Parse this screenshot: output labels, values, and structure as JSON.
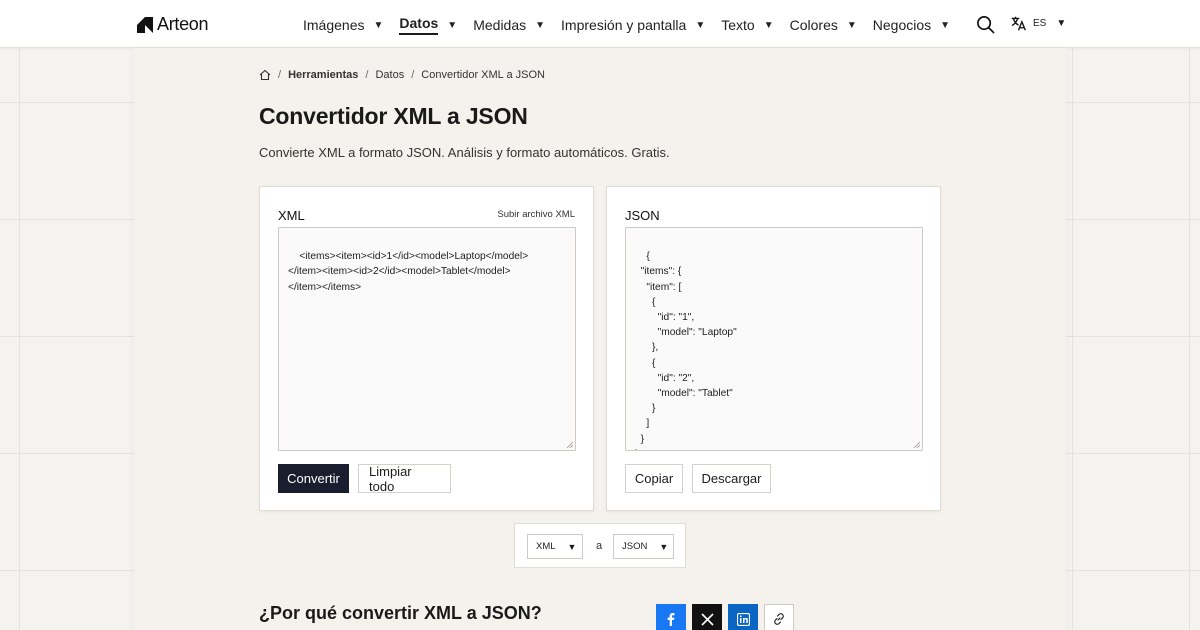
{
  "header": {
    "brand": "Arteon",
    "nav": [
      {
        "label": "Imágenes",
        "active": false
      },
      {
        "label": "Datos",
        "active": true
      },
      {
        "label": "Medidas",
        "active": false
      },
      {
        "label": "Impresión y pantalla",
        "active": false
      },
      {
        "label": "Texto",
        "active": false
      },
      {
        "label": "Colores",
        "active": false
      },
      {
        "label": "Negocios",
        "active": false
      }
    ],
    "language": "ES"
  },
  "breadcrumb": {
    "items": [
      "Herramientas",
      "Datos",
      "Convertidor XML a JSON"
    ],
    "separator": "/"
  },
  "page": {
    "title": "Convertidor XML a JSON",
    "description": "Convierte XML a formato JSON. Análisis y formato automáticos. Gratis."
  },
  "input_card": {
    "label": "XML",
    "upload_link": "Subir archivo XML",
    "value": "<items><item><id>1</id><model>Laptop</model>\n</item><item><id>2</id><model>Tablet</model>\n</item></items>",
    "convert_button": "Convertir",
    "clear_button": "Limpiar todo"
  },
  "output_card": {
    "label": "JSON",
    "value": "{\n  \"items\": {\n    \"item\": [\n      {\n        \"id\": \"1\",\n        \"model\": \"Laptop\"\n      },\n      {\n        \"id\": \"2\",\n        \"model\": \"Tablet\"\n      }\n    ]\n  }\n}",
    "copy_button": "Copiar",
    "download_button": "Descargar"
  },
  "format_selector": {
    "from": "XML",
    "connector": "a",
    "to": "JSON"
  },
  "why_section": {
    "title": "¿Por qué convertir XML a JSON?"
  },
  "share": {
    "facebook_icon": "facebook-icon",
    "x_icon": "x-icon",
    "linkedin_icon": "linkedin-icon",
    "link_icon": "link-icon"
  },
  "colors": {
    "primary_button": "#1a1d2e",
    "facebook": "#1877f2",
    "x": "#111111",
    "linkedin": "#0a66c2",
    "background": "#f5f3ef"
  }
}
